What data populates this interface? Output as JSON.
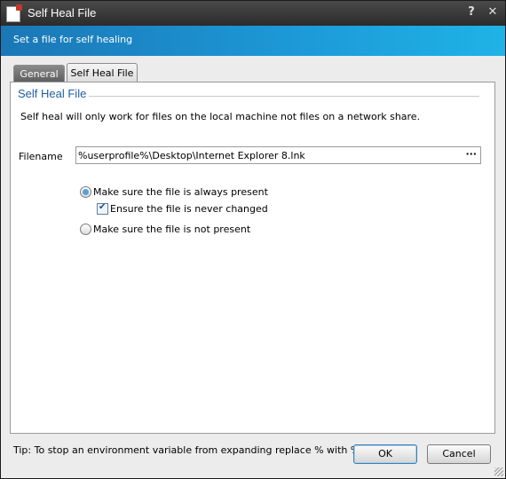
{
  "window": {
    "title": "Self Heal File",
    "help_glyph": "?",
    "close_glyph": "✕"
  },
  "header": {
    "text": "Set a file for self healing"
  },
  "tabs": [
    {
      "label": "General",
      "active": false
    },
    {
      "label": "Self Heal File",
      "active": true
    }
  ],
  "section": {
    "title": "Self Heal File",
    "description": "Self heal will only work for files on the local machine not files on a network share."
  },
  "filename": {
    "label": "Filename",
    "value": "%userprofile%\\Desktop\\Internet Explorer 8.lnk",
    "browse_label": "···"
  },
  "options": {
    "always_present": {
      "label": "Make sure the file is always present",
      "selected": true
    },
    "never_changed": {
      "label": "Ensure the file is never changed",
      "checked": true
    },
    "not_present": {
      "label": "Make sure the file is not present",
      "selected": false
    }
  },
  "tip": "Tip: To stop an environment variable from expanding replace % with %%.",
  "buttons": {
    "ok": "OK",
    "cancel": "Cancel"
  },
  "colors": {
    "accent": "#1d9ad8",
    "title_bar": "#2b2b2b",
    "section_title": "#1f5fa3"
  }
}
